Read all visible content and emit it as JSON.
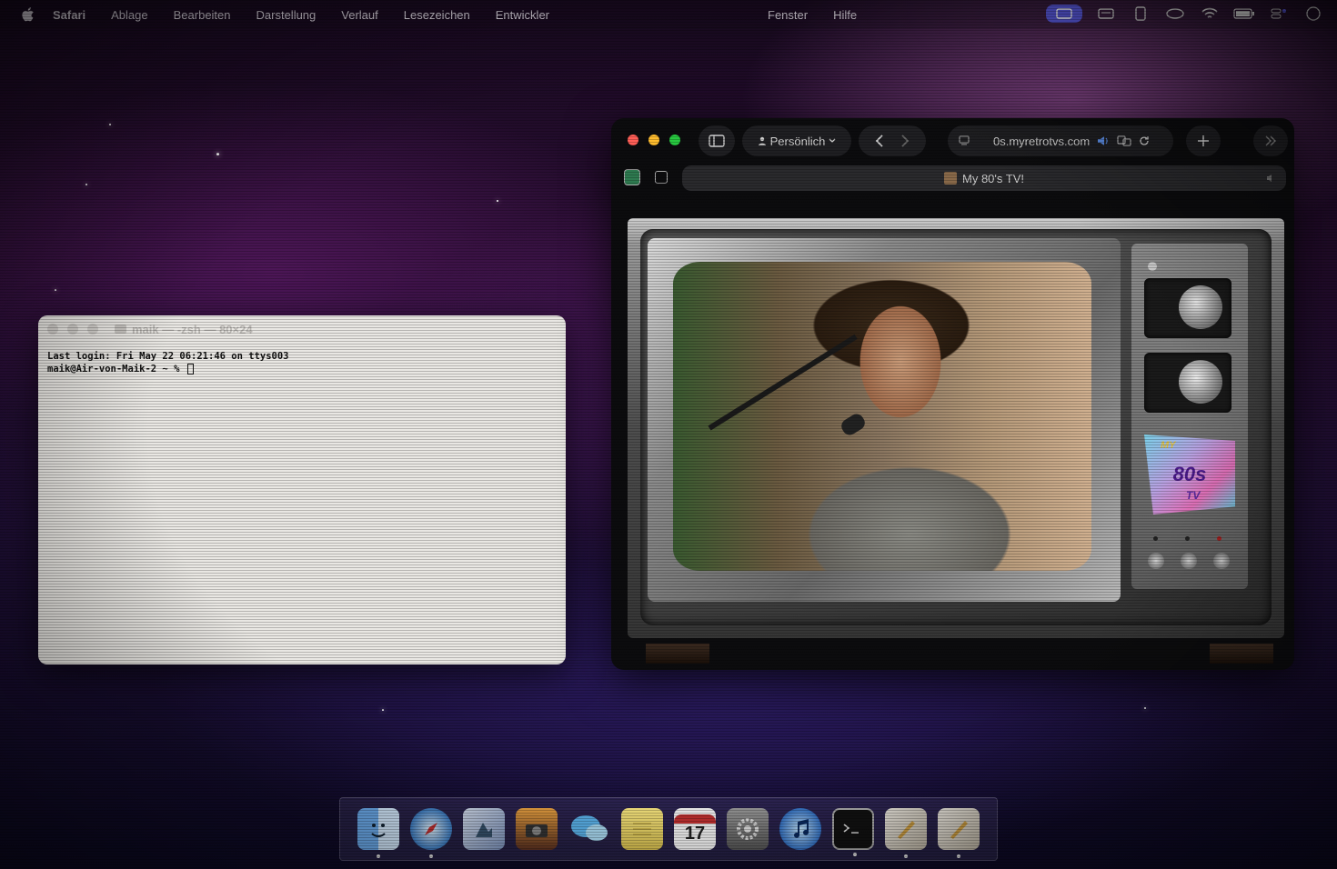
{
  "menubar": {
    "app_name": "Safari",
    "items": [
      "Ablage",
      "Bearbeiten",
      "Darstellung",
      "Verlauf",
      "Lesezeichen",
      "Entwickler"
    ],
    "right_items": [
      "Fenster",
      "Hilfe"
    ]
  },
  "terminal": {
    "title": "maik — -zsh — 80×24",
    "line1": "Last login: Fri May 22 06:21:46 on ttys003",
    "line2": "maik@Air-von-Maik-2 ~ % "
  },
  "safari": {
    "profile_label": "Persönlich",
    "url": "0s.myretrotvs.com",
    "tab_title": "My 80's TV!",
    "tv_logo_line1": "MY",
    "tv_logo_line2": "80s",
    "tv_logo_line3": "TV"
  },
  "colors": {
    "close": "#ff5f57",
    "minimize": "#febc2e",
    "zoom": "#28c840",
    "accent": "#5a5ae0"
  },
  "dock": {
    "apps": [
      "Finder",
      "Safari",
      "Vorschau",
      "Fotos",
      "Nachrichten",
      "Notizen",
      "Kalender",
      "Systemeinstellungen",
      "iTunes",
      "Terminal",
      "Skript-Editor",
      "Skript-Editor"
    ],
    "calendar_day": "17"
  }
}
